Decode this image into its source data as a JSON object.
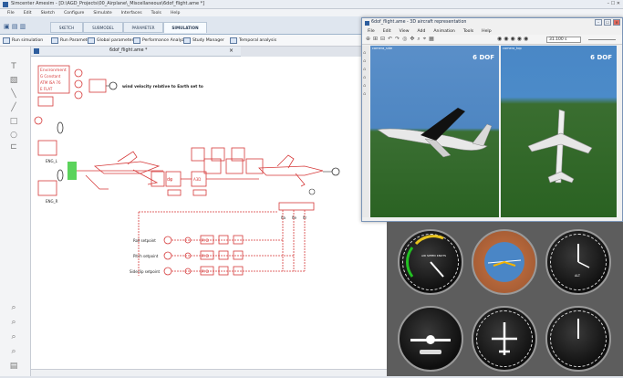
{
  "app": {
    "title": "Simcenter Amesim - [D:\\AGD_Projects\\00_Airplane\\_Miscellaneous\\6dof_flight.ame *]"
  },
  "menu": [
    "File",
    "Edit",
    "Sketch",
    "Configure",
    "Simulate",
    "Interfaces",
    "Tools",
    "Help"
  ],
  "ribbon_tabs": [
    "SKETCH",
    "SUBMODEL",
    "PARAMETER",
    "SIMULATION"
  ],
  "active_tab": "SIMULATION",
  "toolbar": {
    "run": "Run simulation",
    "run_params": "Run Parameters",
    "global_params": "Global parameters",
    "perf": "Performance Analyzer",
    "study": "Study Manager",
    "temporal": "Temporal analysis"
  },
  "document": {
    "tab": "6dof_flight.ame *"
  },
  "canvas": {
    "env_title": "Environment",
    "env_rows": [
      "G  Constant",
      "ATM  ISA 76",
      "E  FLAT"
    ],
    "wind_text": "wind velocity relative to Earth set to",
    "engine_labels": [
      "ENG_L",
      "ENG_R"
    ],
    "setpoints": [
      "Roll setpoint",
      "Pitch setpoint",
      "Sideslip setpoint"
    ],
    "pid": "PI D",
    "dof_box": "6 DOF",
    "ctrl": "A3D",
    "surfaces": [
      "δa",
      "δe",
      "δr"
    ]
  },
  "viewer": {
    "title": "6dof_flight.ame - 3D aircraft representation",
    "menu": [
      "File",
      "Edit",
      "View",
      "Add",
      "Animation",
      "Tools",
      "Help"
    ],
    "time": "31.100 s",
    "left_label": "camera_side",
    "right_label": "camera_top",
    "left_dof": "6 DOF",
    "right_dof": "6 DOF"
  },
  "instruments": {
    "gauges": [
      "airspeed",
      "attitude",
      "altimeter",
      "turn-coordinator",
      "heading",
      "vertical-speed"
    ],
    "airspeed_text": "AIR SPEED KNOTS",
    "alt_text": "ALT"
  },
  "colors": {
    "diagram": "#d63a3a",
    "sky": "#4d88c7",
    "grass": "#2d6b22",
    "panel": "#5d5d5d"
  }
}
